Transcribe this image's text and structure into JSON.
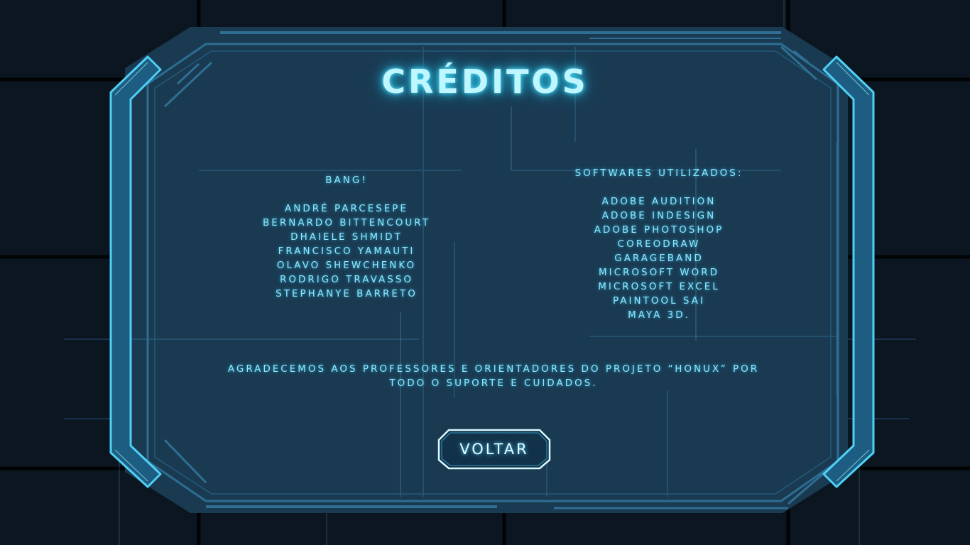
{
  "screen": {
    "title": "CRÉDITOS"
  },
  "team": {
    "heading": "BANG!",
    "members": [
      "ANDRÉ PARCESEPE",
      "BERNARDO BITTENCOURT",
      "DHAIELE SHMIDT",
      "FRANCISCO YAMAUTI",
      "OLAVO SHEWCHENKO",
      "RODRIGO TRAVASSO",
      "STEPHANYE BARRETO"
    ]
  },
  "software": {
    "heading": "SOFTWARES UTILIZADOS:",
    "items": [
      "ADOBE AUDITION",
      "ADOBE INDESIGN",
      "ADOBE PHOTOSHOP",
      "COREODRAW",
      "GARAGEBAND",
      "MICROSOFT WORD",
      "MICROSOFT EXCEL",
      "PAINTOOL SAI",
      "MAYA 3D."
    ]
  },
  "thanks": {
    "line1": "AGRADECEMOS AOS PROFESSORES E ORIENTADORES DO PROJETO “HONUX” POR",
    "line2": "TODO O SUPORTE E CUIDADOS."
  },
  "back_button": {
    "label": "VOLTAR"
  },
  "colors": {
    "accent": "#3fc6ec",
    "text": "#8fe6ff",
    "panel": "#1a3a52",
    "background": "#0b1620"
  }
}
